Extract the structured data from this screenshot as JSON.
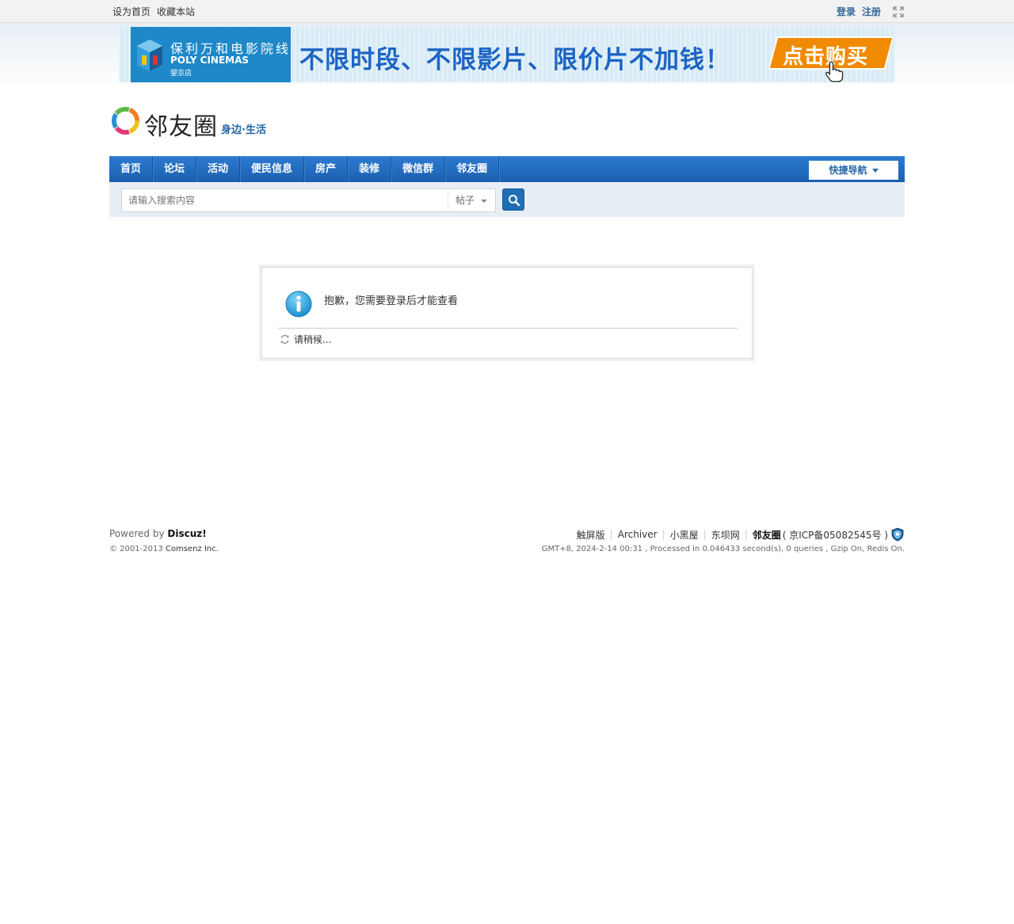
{
  "topbar": {
    "set_home": "设为首页",
    "bookmark": "收藏本站",
    "login": "登录",
    "register": "注册"
  },
  "banner": {
    "cinema_cn": "保利万和电影院线",
    "cinema_en": "POLY CINEMAS",
    "branch": "望京店",
    "slogan": "不限时段、不限影片、限价片不加钱！",
    "buy_label": "点击购买"
  },
  "logo": {
    "name": "邻友圈",
    "tagline": "身边·生活"
  },
  "nav": {
    "items": [
      "首页",
      "论坛",
      "活动",
      "便民信息",
      "房产",
      "装修",
      "微信群",
      "邻友圈"
    ],
    "quick_nav": "快捷导航"
  },
  "search": {
    "placeholder": "请输入搜索内容",
    "type": "帖子"
  },
  "message": {
    "text": "抱歉，您需要登录后才能查看",
    "waiting": "请稍候..."
  },
  "footer": {
    "powered_prefix": "Powered by ",
    "powered_brand": "Discuz!",
    "copyright_prefix": "© 2001-2013 ",
    "copyright_company": "Comsenz Inc.",
    "links": [
      "触屏版",
      "Archiver",
      "小黑屋",
      "东坝网"
    ],
    "site_name": "邻友圈",
    "icp": "( 京ICP备05082545号 )",
    "processed": "GMT+8, 2024-2-14 00:31 , Processed in 0.046433 second(s), 0 queries , Gzip On, Redis On."
  },
  "colors": {
    "nav_blue": "#1f68bc",
    "link_blue": "#336699",
    "banner_orange": "#f08a00"
  }
}
